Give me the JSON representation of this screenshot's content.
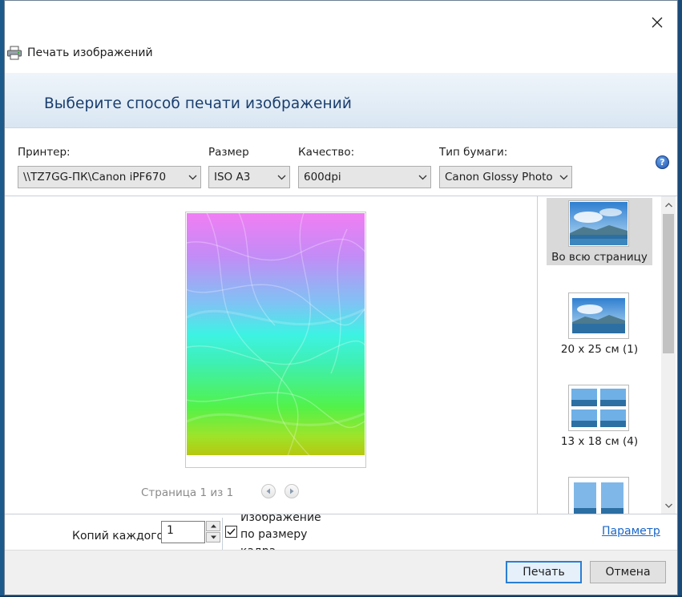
{
  "window": {
    "title": "Печать изображений",
    "heading": "Выберите способ печати изображений"
  },
  "settings": {
    "printer": {
      "label": "Принтер:",
      "value": "\\\\TZ7GG-ПК\\Canon iPF670"
    },
    "size": {
      "label": "Размер",
      "value": "ISO A3"
    },
    "quality": {
      "label": "Качество:",
      "value": "600dpi"
    },
    "paper_type": {
      "label": "Тип бумаги:",
      "value": "Canon Glossy Photo Paper"
    }
  },
  "preview": {
    "pager_text": "Страница 1 из 1"
  },
  "layouts": [
    {
      "label": "Во всю страницу",
      "selected": true
    },
    {
      "label": "20 х 25 см (1)",
      "selected": false
    },
    {
      "label": "13 х 18 см (4)",
      "selected": false
    },
    {
      "label": "",
      "selected": false
    }
  ],
  "bottom": {
    "copies_label": "Копий каждого",
    "copies_value": "1",
    "fit_label": "Изображение по размеру кадра",
    "fit_checked": true,
    "options_link": "Параметр"
  },
  "footer": {
    "print_button": "Печать",
    "cancel_button": "Отмена"
  },
  "colors": {
    "heading": "#1a3e6e",
    "link": "#1b66c9",
    "selected_layout": "#d9d9d9",
    "default_button_border": "#2a7fd4"
  }
}
